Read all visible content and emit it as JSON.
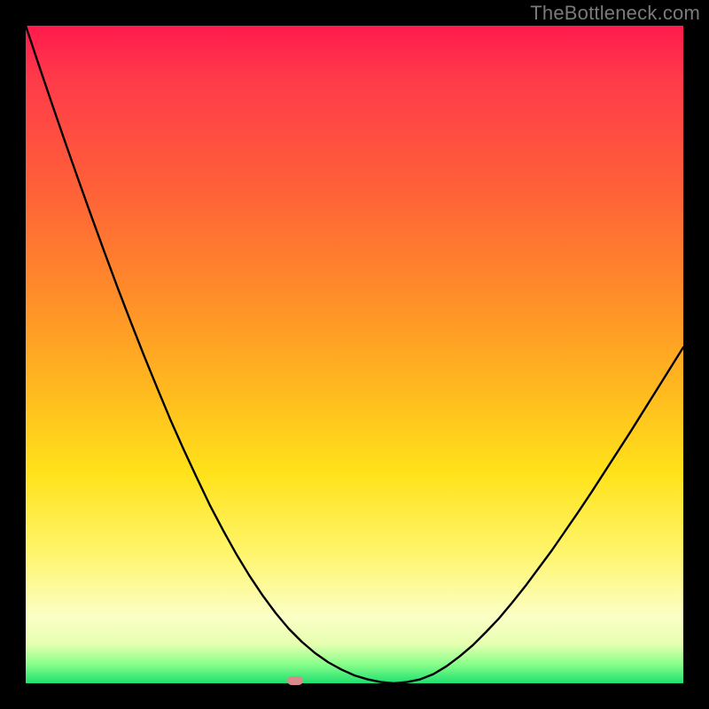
{
  "watermark": "TheBottleneck.com",
  "colors": {
    "frame": "#000000",
    "curve": "#000000",
    "marker": "#d98a8a",
    "gradient_stops": [
      "#ff1a4d",
      "#ff3a4a",
      "#ff6138",
      "#ff8a2a",
      "#ffb81f",
      "#ffe21a",
      "#fff56a",
      "#fbffc6",
      "#e6ffb0",
      "#8cff8c",
      "#1fe06f"
    ]
  },
  "chart_data": {
    "type": "line",
    "title": "",
    "xlabel": "",
    "ylabel": "",
    "xlim": [
      0,
      100
    ],
    "ylim": [
      0,
      100
    ],
    "x": [
      0,
      2,
      4,
      6,
      8,
      10,
      12,
      14,
      16,
      18,
      20,
      22,
      24,
      26,
      28,
      30,
      32,
      34,
      36,
      38,
      40,
      42,
      44,
      46,
      48,
      50,
      52,
      54,
      56,
      58,
      60,
      62,
      64,
      66,
      68,
      70,
      72,
      74,
      76,
      78,
      80,
      82,
      84,
      86,
      88,
      90,
      92,
      94,
      96,
      98,
      100
    ],
    "values": [
      100.0,
      94.0,
      88.1,
      82.3,
      76.6,
      71.0,
      65.5,
      60.1,
      54.9,
      49.8,
      44.9,
      40.1,
      35.6,
      31.3,
      27.1,
      23.3,
      19.7,
      16.4,
      13.4,
      10.7,
      8.3,
      6.3,
      4.6,
      3.2,
      2.1,
      1.2,
      0.6,
      0.2,
      0.0,
      0.2,
      0.6,
      1.4,
      2.6,
      4.1,
      5.8,
      7.8,
      9.9,
      12.3,
      14.8,
      17.5,
      20.2,
      23.1,
      26.0,
      29.0,
      32.1,
      35.2,
      38.3,
      41.5,
      44.7,
      47.9,
      51.1
    ],
    "vertex_x": 41,
    "marker": {
      "x": 41,
      "y": 0
    },
    "annotations": []
  }
}
